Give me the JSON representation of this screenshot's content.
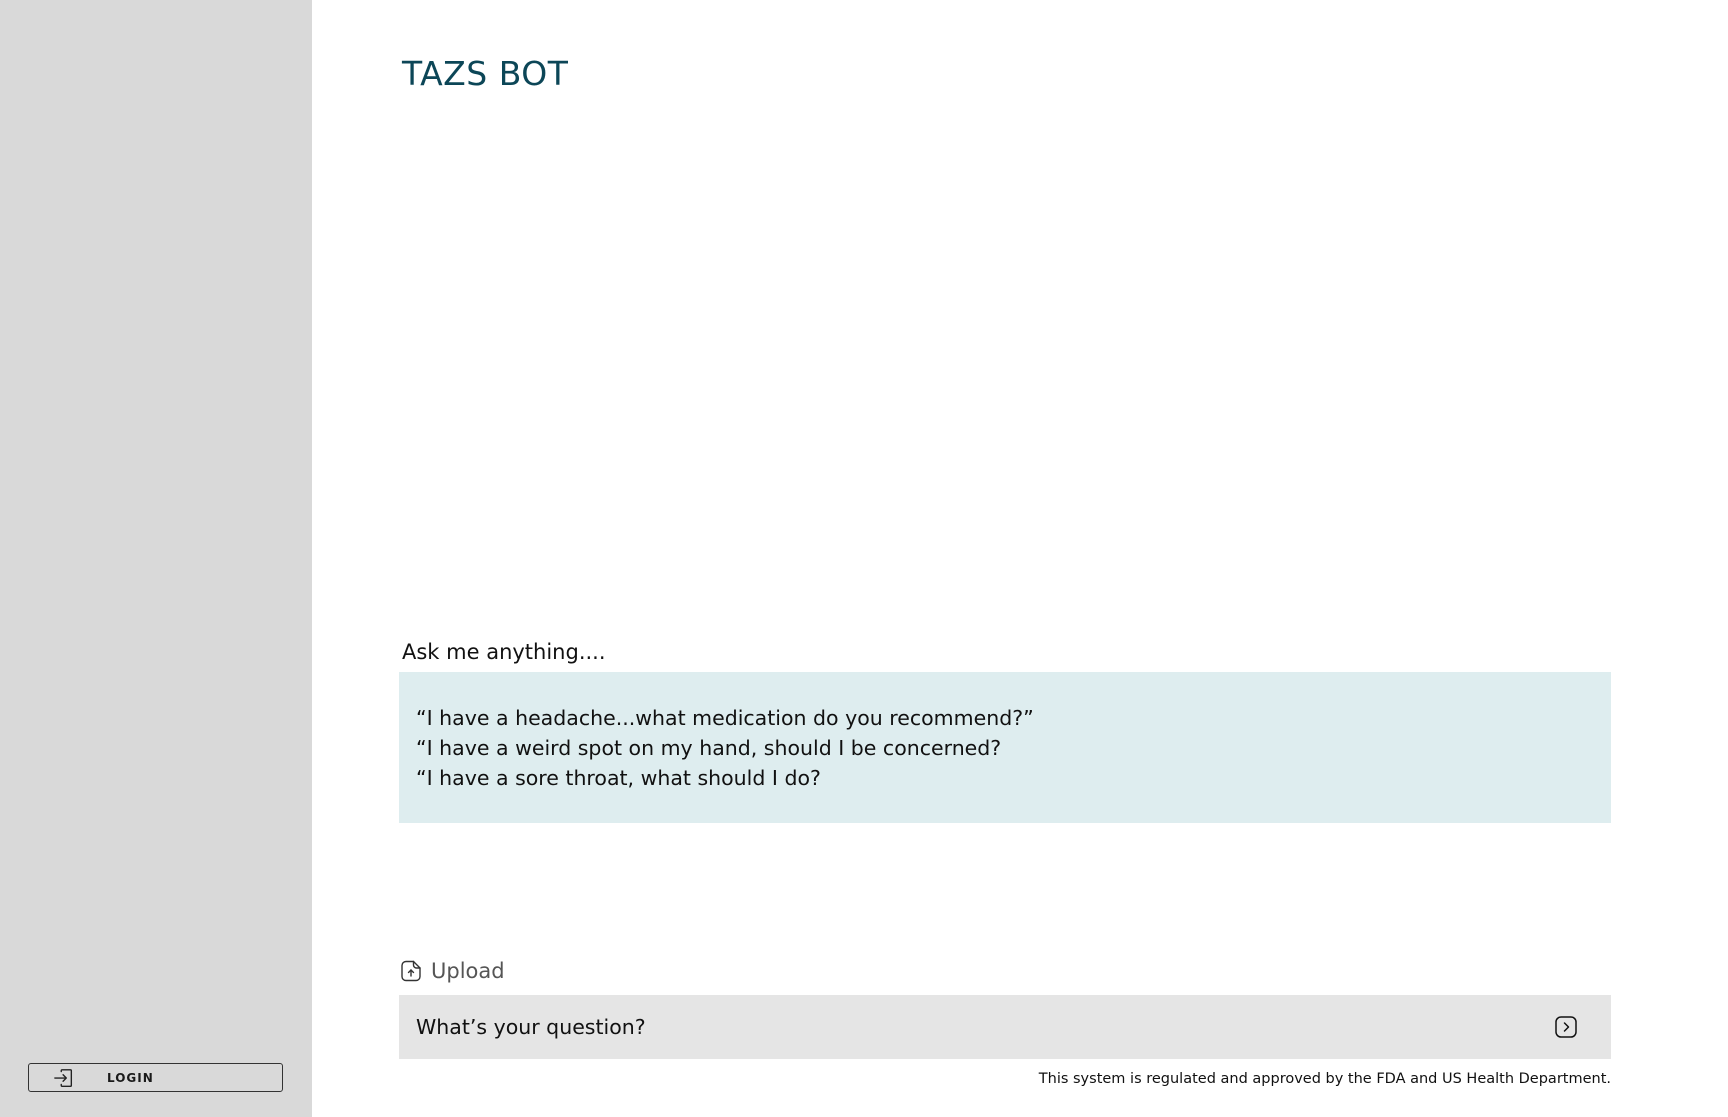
{
  "app": {
    "title": "TAZS BOT"
  },
  "sidebar": {
    "login": {
      "label": "LOGIN",
      "icon": "login-icon"
    }
  },
  "main": {
    "prompt_label": "Ask me anything....",
    "examples": [
      "“I have a headache...what medication do you recommend?”",
      "“I have a weird spot on my hand, should I be concerned?",
      "“I have a sore throat, what should I do?"
    ],
    "upload": {
      "label": "Upload",
      "icon": "file-upload-icon"
    },
    "question": {
      "placeholder": "What’s your question?",
      "value": ""
    },
    "send": {
      "icon": "chevron-right-icon"
    },
    "disclaimer": "This system is regulated and approved by the FDA and US Health Department."
  },
  "colors": {
    "sidebar_bg": "#d9d9d9",
    "title": "#0c4657",
    "examples_bg": "#deedef",
    "input_bg": "#e5e5e5"
  }
}
